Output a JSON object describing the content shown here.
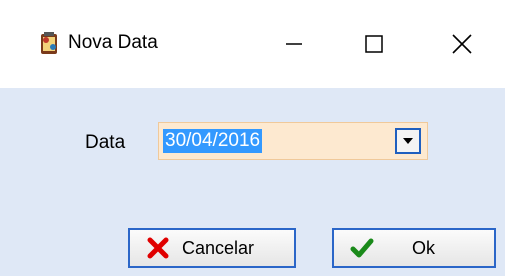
{
  "window": {
    "title": "Nova Data",
    "app_icon": "app-icon",
    "controls": {
      "minimize_icon": "minimize-icon",
      "maximize_icon": "maximize-icon",
      "close_icon": "close-icon"
    }
  },
  "form": {
    "date_label": "Data",
    "date_value": "30/04/2016",
    "dropdown_icon": "chevron-down-icon"
  },
  "buttons": {
    "cancel_label": "Cancelar",
    "cancel_icon": "x-icon",
    "ok_label": "Ok",
    "ok_icon": "checkmark-icon"
  },
  "colors": {
    "body_background": "#dfe8f6",
    "field_background": "#fde9d0",
    "selection": "#3399ff",
    "button_border": "#2b66c8",
    "cancel_icon": "#e00000",
    "ok_icon": "#1a8a1a"
  }
}
